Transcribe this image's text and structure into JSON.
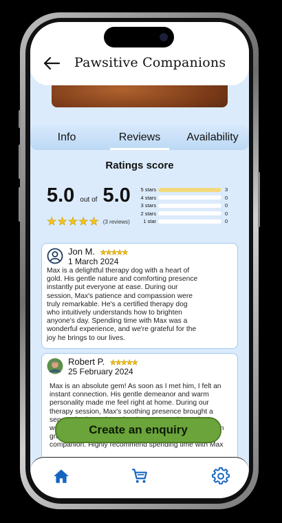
{
  "app": {
    "title": "Pawsitive Companions"
  },
  "tabs": [
    {
      "label": "Info"
    },
    {
      "label": "Reviews",
      "active": true
    },
    {
      "label": "Availability"
    }
  ],
  "ratings": {
    "heading": "Ratings score",
    "score": "5.0",
    "out_of_text": "out of",
    "max": "5.0",
    "reviews_count": "(3 reviews)",
    "stars": 5,
    "distribution": [
      {
        "label": "5 stars",
        "count": "3",
        "fraction": 1.0
      },
      {
        "label": "4 stars",
        "count": "0",
        "fraction": 0
      },
      {
        "label": "3 stars",
        "count": "0",
        "fraction": 0
      },
      {
        "label": "2 stars",
        "count": "0",
        "fraction": 0
      },
      {
        "label": "1 star",
        "count": "0",
        "fraction": 0
      }
    ]
  },
  "reviews": [
    {
      "name": "Jon M.",
      "stars": "★★★★★",
      "date": "1 March 2024",
      "text": "Max is a delightful therapy dog with a heart of gold. His gentle nature and comforting presence instantly put everyone at ease. During our session, Max's patience and compassion were truly remarkable. He's a certified therapy dog who intuitively understands how to brighten anyone's day. Spending time with Max was a wonderful experience, and we're grateful for the joy he brings to our lives."
    },
    {
      "name": "Robert P.",
      "stars": "★★★★★",
      "date": "25 February 2024",
      "text": "Max is an absolute gem! As soon as I met him, I felt an instant connection. His gentle demeanor and warm personality made me feel right at home. During our therapy session, Max's soothing presence brought a sense of calm and comfort that I can't quite put into words. He's gentle, attentive, and a true companion. I'm grateful for the opportunity to have him as a therapy companion. Highly recommend spending time with Max"
    }
  ],
  "cta": {
    "label": "Create an enquiry"
  },
  "nav": {
    "items": [
      "home-icon",
      "cart-icon",
      "settings-icon"
    ],
    "accent": "#1565c0"
  }
}
